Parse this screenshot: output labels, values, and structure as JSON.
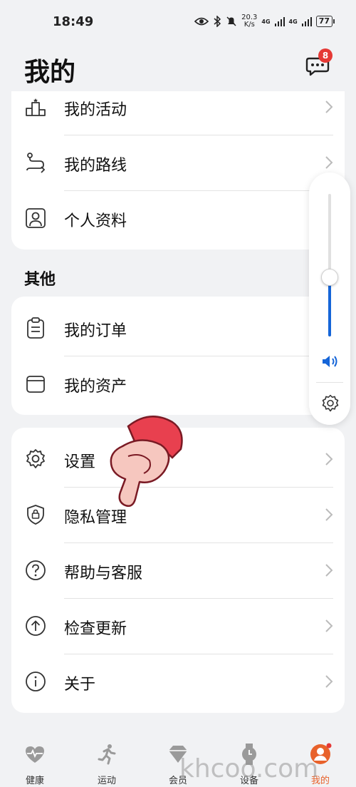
{
  "status_bar": {
    "time": "18:49",
    "speed_value": "20.3",
    "speed_unit": "K/s",
    "sig1": "4G",
    "sig2": "4G",
    "battery": "77"
  },
  "header": {
    "title": "我的",
    "message_badge": "8"
  },
  "group1": [
    {
      "label": "我的活动",
      "icon": "podium-icon"
    },
    {
      "label": "我的路线",
      "icon": "route-icon"
    },
    {
      "label": "个人资料",
      "icon": "profile-icon"
    }
  ],
  "section_other": {
    "title": "其他"
  },
  "group2": [
    {
      "label": "我的订单",
      "icon": "clipboard-icon"
    },
    {
      "label": "我的资产",
      "icon": "box-icon"
    }
  ],
  "group3": [
    {
      "label": "设置",
      "icon": "gear-icon"
    },
    {
      "label": "隐私管理",
      "icon": "shield-lock-icon"
    },
    {
      "label": "帮助与客服",
      "icon": "help-icon"
    },
    {
      "label": "检查更新",
      "icon": "upload-icon"
    },
    {
      "label": "关于",
      "icon": "info-icon"
    }
  ],
  "volume": {
    "level": 0.42
  },
  "tabs": [
    {
      "label": "健康",
      "icon": "heart-pulse-icon"
    },
    {
      "label": "运动",
      "icon": "runner-icon"
    },
    {
      "label": "会员",
      "icon": "diamond-icon"
    },
    {
      "label": "设备",
      "icon": "watch-icon"
    },
    {
      "label": "我的",
      "icon": "user-icon"
    }
  ],
  "watermark": "khcoo.com",
  "colors": {
    "accent": "#e8622b",
    "volume": "#1565d8",
    "badge": "#e53935"
  }
}
